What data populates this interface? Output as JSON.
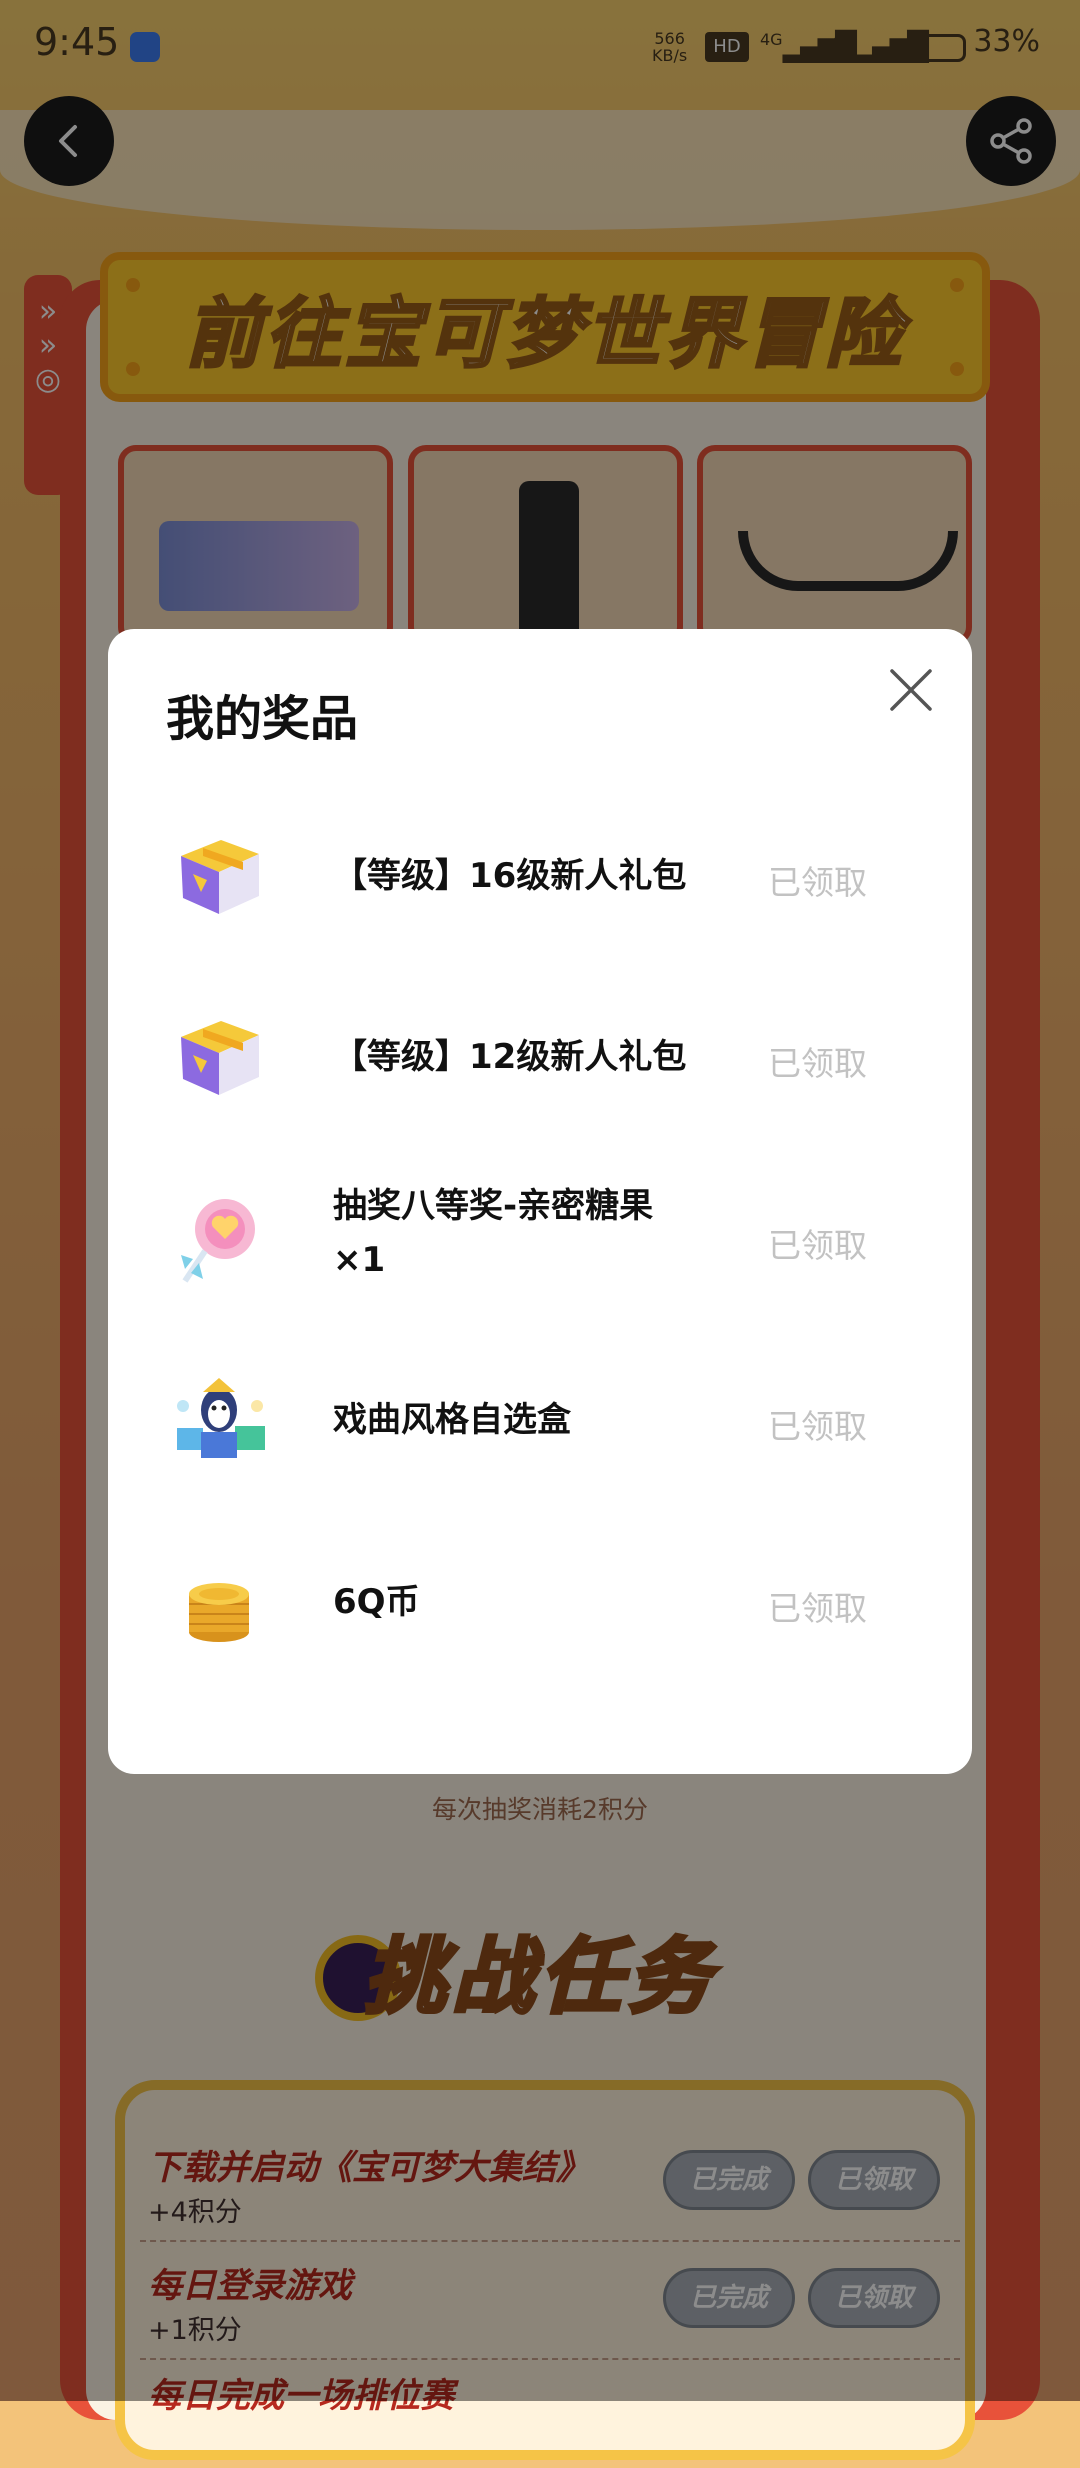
{
  "status_bar": {
    "time": "9:45",
    "net_speed_value": "566",
    "net_speed_unit": "KB/s",
    "hd_label": "HD",
    "signal_1": "4G",
    "signal_2": "4G",
    "battery": "33%"
  },
  "header": {
    "back_icon": "chevron-left-icon",
    "share_icon": "share-icon"
  },
  "background_page": {
    "banner_title": "前往宝可梦世界冒险",
    "cost_text": "每次抽奖消耗2积分",
    "challenge_title": "挑战任务",
    "tasks": [
      {
        "title": "下载并启动《宝可梦大集结》",
        "points": "+4积分",
        "done": "已完成",
        "claimed": "已领取"
      },
      {
        "title": "每日登录游戏",
        "points": "+1积分",
        "done": "已完成",
        "claimed": "已领取"
      },
      {
        "title": "每日完成一场排位赛",
        "points": "",
        "done": "",
        "claimed": ""
      }
    ]
  },
  "modal": {
    "title": "我的奖品",
    "close_icon": "close-icon",
    "prizes": [
      {
        "name": "【等级】16级新人礼包",
        "status": "已领取",
        "icon": "gift-box-icon"
      },
      {
        "name": "【等级】12级新人礼包",
        "status": "已领取",
        "icon": "gift-box-icon"
      },
      {
        "name_line1": "抽奖八等奖-亲密糖果",
        "name_line2": "×1",
        "status": "已领取",
        "icon": "lollipop-icon"
      },
      {
        "name": "戏曲风格自选盒",
        "status": "已领取",
        "icon": "mystery-box-icon"
      },
      {
        "name": "6Q币",
        "status": "已领取",
        "icon": "coin-stack-icon"
      }
    ]
  },
  "colors": {
    "overlay": "rgba(0,0,0,0.45)",
    "claimed_text": "#c2c2c2",
    "frame_red": "#e8523a",
    "banner_yellow": "#ffcb2d"
  }
}
